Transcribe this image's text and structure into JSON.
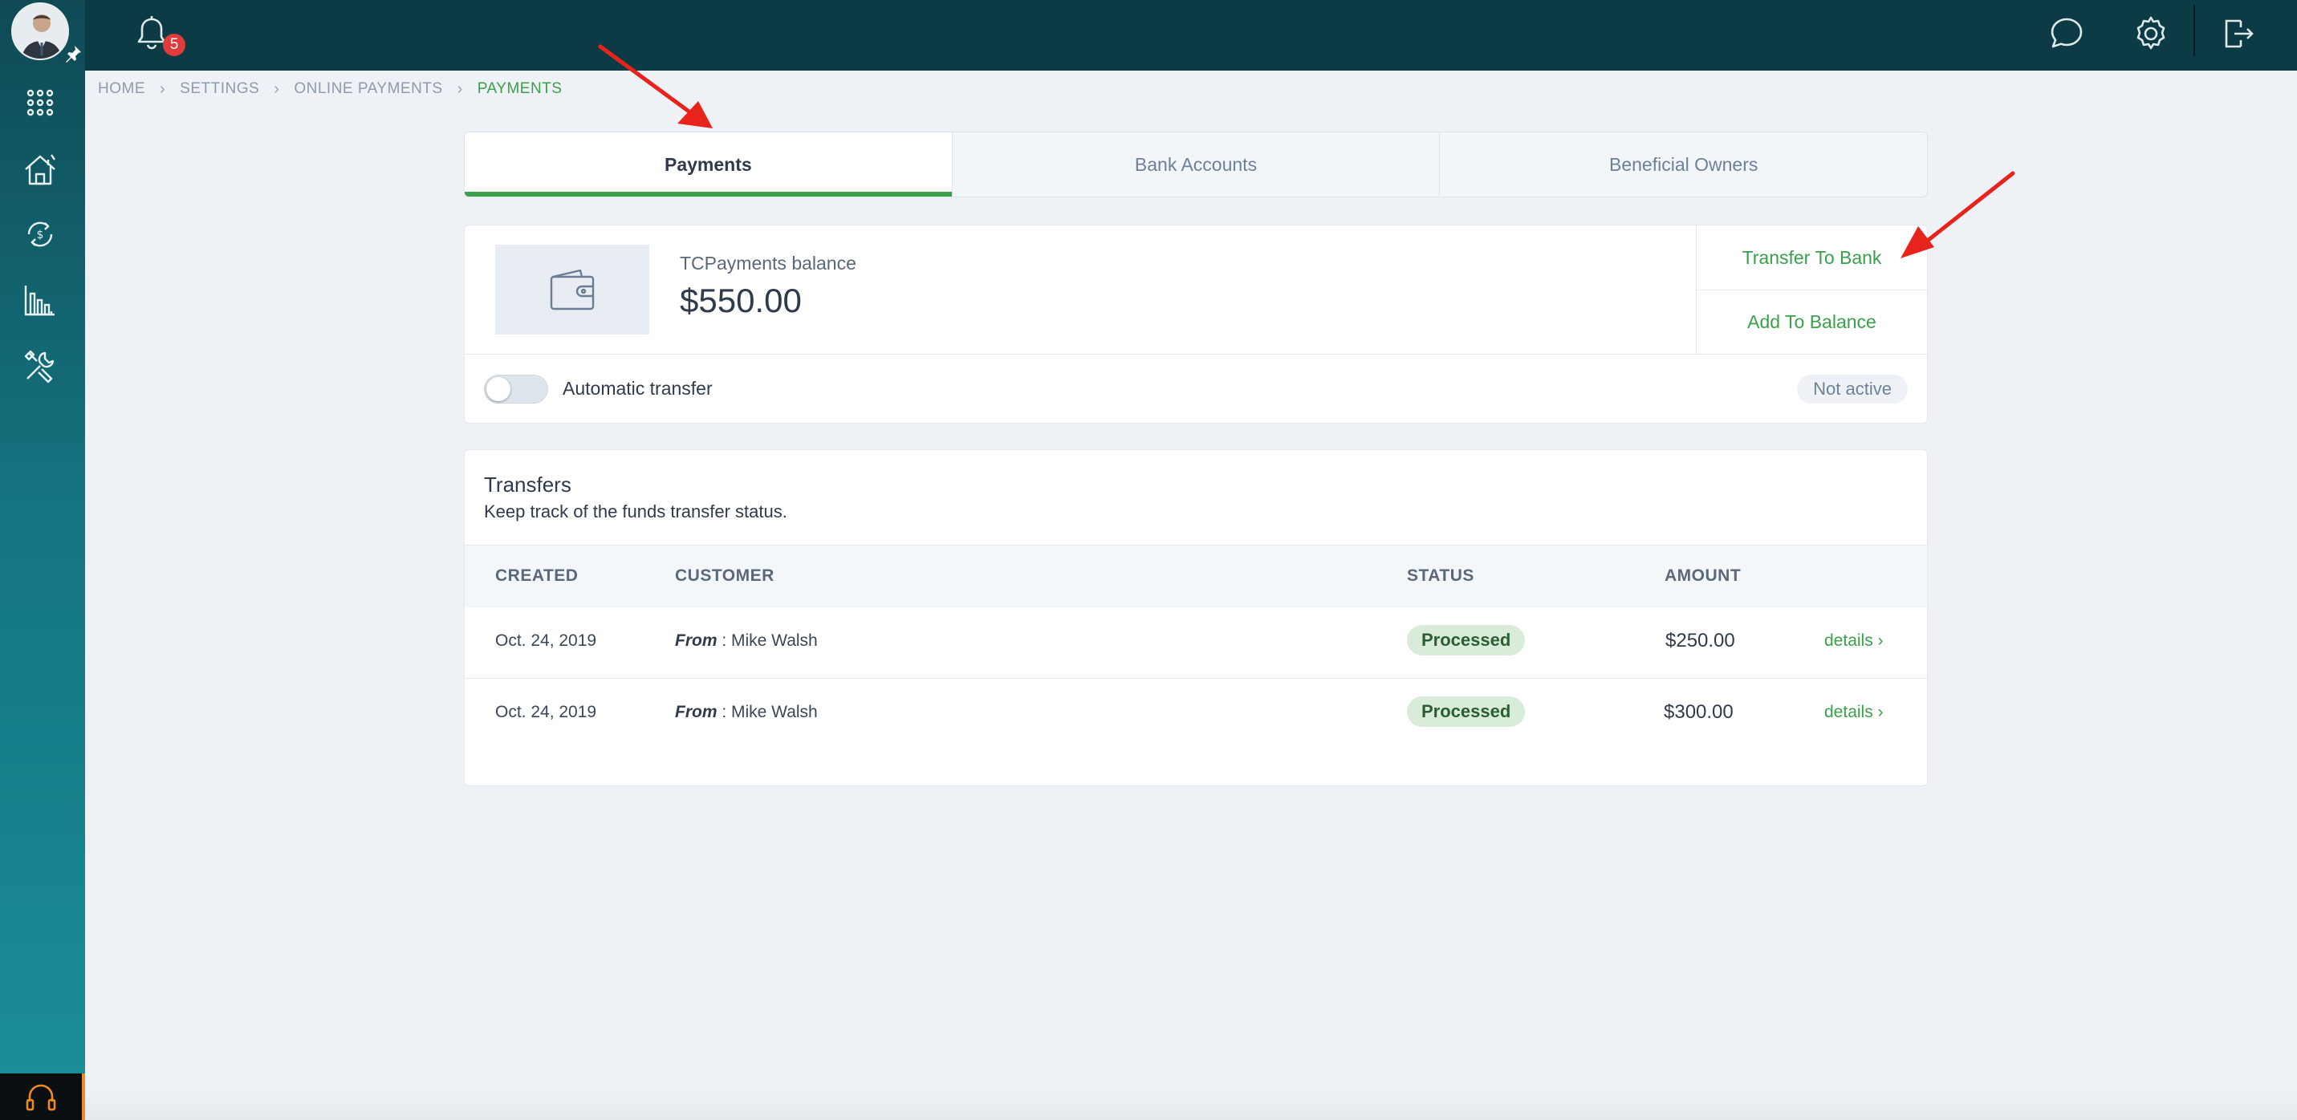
{
  "notifications": {
    "count": "5"
  },
  "breadcrumb": [
    "HOME",
    "SETTINGS",
    "ONLINE PAYMENTS",
    "PAYMENTS"
  ],
  "tabs": [
    {
      "label": "Payments",
      "active": true
    },
    {
      "label": "Bank Accounts",
      "active": false
    },
    {
      "label": "Beneficial Owners",
      "active": false
    }
  ],
  "balance": {
    "label": "TCPayments balance",
    "amount": "$550.00",
    "actions": {
      "transfer": "Transfer To Bank",
      "add": "Add To Balance"
    },
    "auto_transfer": {
      "label": "Automatic transfer",
      "enabled": false,
      "status": "Not active"
    }
  },
  "transfers": {
    "title": "Transfers",
    "subtitle": "Keep track of the funds transfer status.",
    "columns": [
      "CREATED",
      "CUSTOMER",
      "STATUS",
      "AMOUNT"
    ],
    "rows": [
      {
        "created": "Oct. 24, 2019",
        "from_label": "From",
        "customer": " : Mike Walsh",
        "status": "Processed",
        "amount": "$250.00",
        "link": "details"
      },
      {
        "created": "Oct. 24, 2019",
        "from_label": "From",
        "customer": " : Mike Walsh",
        "status": "Processed",
        "amount": "$300.00",
        "link": "details"
      }
    ]
  },
  "colors": {
    "accent": "#3aa04a",
    "topbar": "#0c3b45",
    "sidebar": "#147480",
    "badge": "#e23b3b",
    "annotation": "#e8231c"
  },
  "icons": [
    "apps-grid-icon",
    "property-icon",
    "money-exchange-icon",
    "reports-icon",
    "tools-icon",
    "headset-icon",
    "bell-icon",
    "chat-icon",
    "gear-icon",
    "logout-icon",
    "wallet-icon",
    "chevron-right-icon",
    "pin-icon"
  ]
}
